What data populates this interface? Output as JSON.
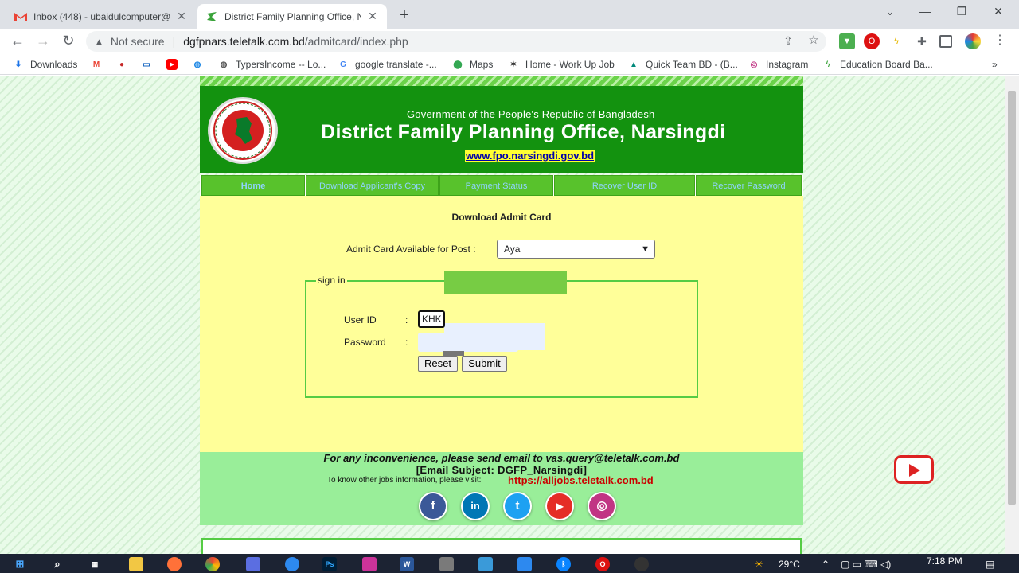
{
  "browser": {
    "tabs": [
      {
        "title": "Inbox (448) - ubaidulcomputer@",
        "icon": "gmail-icon",
        "active": false
      },
      {
        "title": "District Family Planning Office, N",
        "icon": "teletalk-icon",
        "active": true
      }
    ],
    "new_tab": "+",
    "security_label": "Not secure",
    "url_host": "dgfpnars.teletalk.com.bd",
    "url_path": "/admitcard/index.php",
    "bookmarks": [
      {
        "label": "Downloads",
        "icon": "download-icon"
      },
      {
        "label": "",
        "icon": "gmail-icon"
      },
      {
        "label": "",
        "icon": "app-icon"
      },
      {
        "label": "",
        "icon": "monitor-icon"
      },
      {
        "label": "",
        "icon": "youtube-icon"
      },
      {
        "label": "",
        "icon": "globe-icon"
      },
      {
        "label": "TypersIncome -- Lo...",
        "icon": "globe-icon"
      },
      {
        "label": "google translate -...",
        "icon": "google-icon"
      },
      {
        "label": "Maps",
        "icon": "maps-icon"
      },
      {
        "label": "Home - Work Up Job",
        "icon": "star-icon"
      },
      {
        "label": "Quick Team BD - (B...",
        "icon": "cap-icon"
      },
      {
        "label": "Instagram",
        "icon": "instagram-icon"
      },
      {
        "label": "Education Board Ba...",
        "icon": "teletalk-icon"
      }
    ],
    "bookmarks_more": "»"
  },
  "page": {
    "gov_line": "Government of the People's Republic of Bangladesh",
    "office_title": "District Family Planning Office, Narsingdi",
    "office_link": "www.fpo.narsingdi.gov.bd",
    "nav": [
      "Home",
      "Download Applicant's Copy",
      "Payment Status",
      "Recover User ID",
      "Recover Password"
    ],
    "form_title": "Download Admit Card",
    "post_label": "Admit Card Available for Post :",
    "post_selected": "Aya",
    "legend": "sign in",
    "user_id_label": "User ID",
    "password_label": "Password",
    "colon": ":",
    "user_id_value": "KHK",
    "reset_label": "Reset",
    "submit_label": "Submit",
    "footer_line1": "For any inconvenience, please send email to vas.query@teletalk.com.bd",
    "footer_line2": "[Email Subject: DGFP_Narsingdi]",
    "footer_line3": "To know other jobs information, please visit:",
    "footer_link": "https://alljobs.teletalk.com.bd",
    "social": [
      {
        "name": "facebook",
        "glyph": "f",
        "color": "#3b5998"
      },
      {
        "name": "linkedin",
        "glyph": "in",
        "color": "#0077b5"
      },
      {
        "name": "twitter",
        "glyph": "t",
        "color": "#1da1f2"
      },
      {
        "name": "youtube",
        "glyph": "▶",
        "color": "#e52d27"
      },
      {
        "name": "instagram",
        "glyph": "◎",
        "color": "#c13584"
      }
    ]
  },
  "taskbar": {
    "weather": "29°C",
    "time": "7:18 PM"
  },
  "colors": {
    "header_green": "#13920f",
    "content_yellow": "#ffff99",
    "footer_green": "#99ee99",
    "link_red": "#cc0000"
  }
}
